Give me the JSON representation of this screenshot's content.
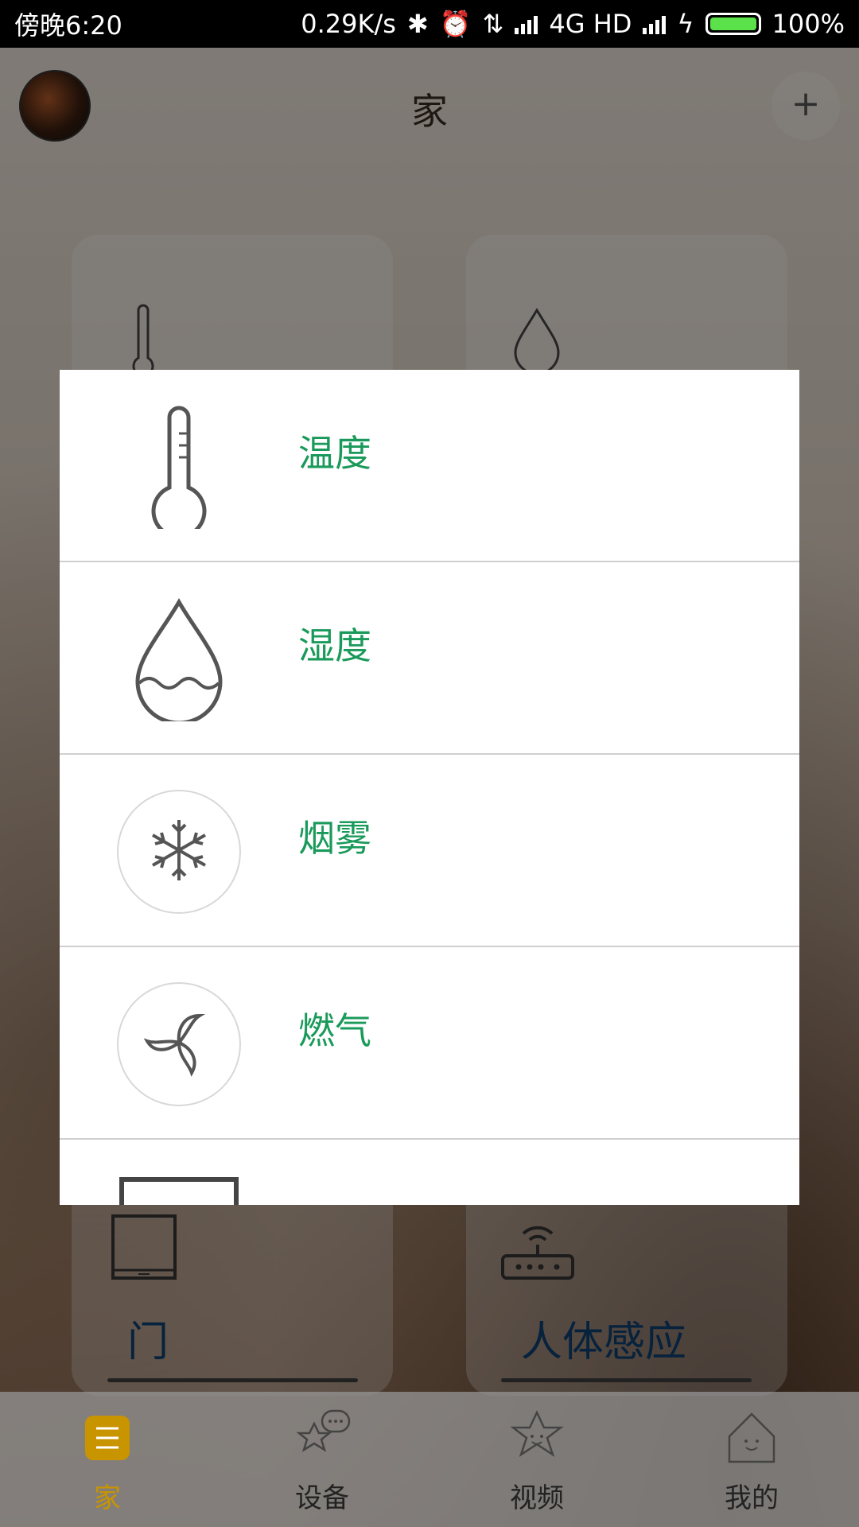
{
  "status_bar": {
    "time": "傍晚6:20",
    "net_speed": "0.29K/s",
    "network": "4G HD",
    "battery": "100%",
    "battery_level": 1.0
  },
  "header": {
    "title": "家",
    "add_label": "+"
  },
  "background_cards": [
    {
      "label": "门"
    },
    {
      "label": "人体感应"
    }
  ],
  "dialog": {
    "items": [
      {
        "label": "温度",
        "icon": "thermometer-icon"
      },
      {
        "label": "湿度",
        "icon": "water-drop-icon"
      },
      {
        "label": "烟雾",
        "icon": "snowflake-icon"
      },
      {
        "label": "燃气",
        "icon": "fan-icon"
      },
      {
        "label": "",
        "icon": "door-sensor-icon"
      }
    ]
  },
  "bottom_nav": {
    "items": [
      {
        "label": "家",
        "icon": "home-menu-icon",
        "active": true
      },
      {
        "label": "设备",
        "icon": "device-chat-icon",
        "active": false
      },
      {
        "label": "视频",
        "icon": "star-face-icon",
        "active": false
      },
      {
        "label": "我的",
        "icon": "house-face-icon",
        "active": false
      }
    ]
  },
  "colors": {
    "accent_green": "#1a9a5a",
    "active_tab": "#c89400",
    "card_label": "#0d3f6e"
  }
}
